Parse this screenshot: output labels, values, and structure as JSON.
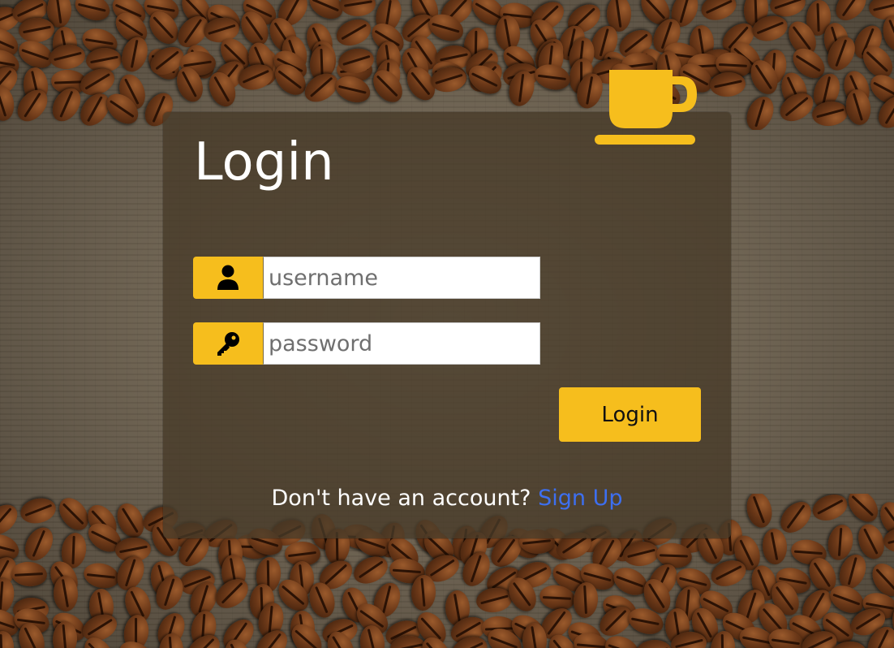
{
  "login_form": {
    "title": "Login",
    "username": {
      "placeholder": "username",
      "value": "",
      "icon": "user-icon"
    },
    "password": {
      "placeholder": "password",
      "value": "",
      "icon": "key-icon"
    },
    "submit_label": "Login",
    "signup_prompt": "Don't have an account?",
    "signup_link": "Sign Up"
  },
  "branding": {
    "logo_icon": "coffee-cup-icon"
  },
  "colors": {
    "accent": "#f6be1d",
    "link": "#3d6ff0",
    "panel": "#463a28",
    "text_light": "#ffffff"
  }
}
